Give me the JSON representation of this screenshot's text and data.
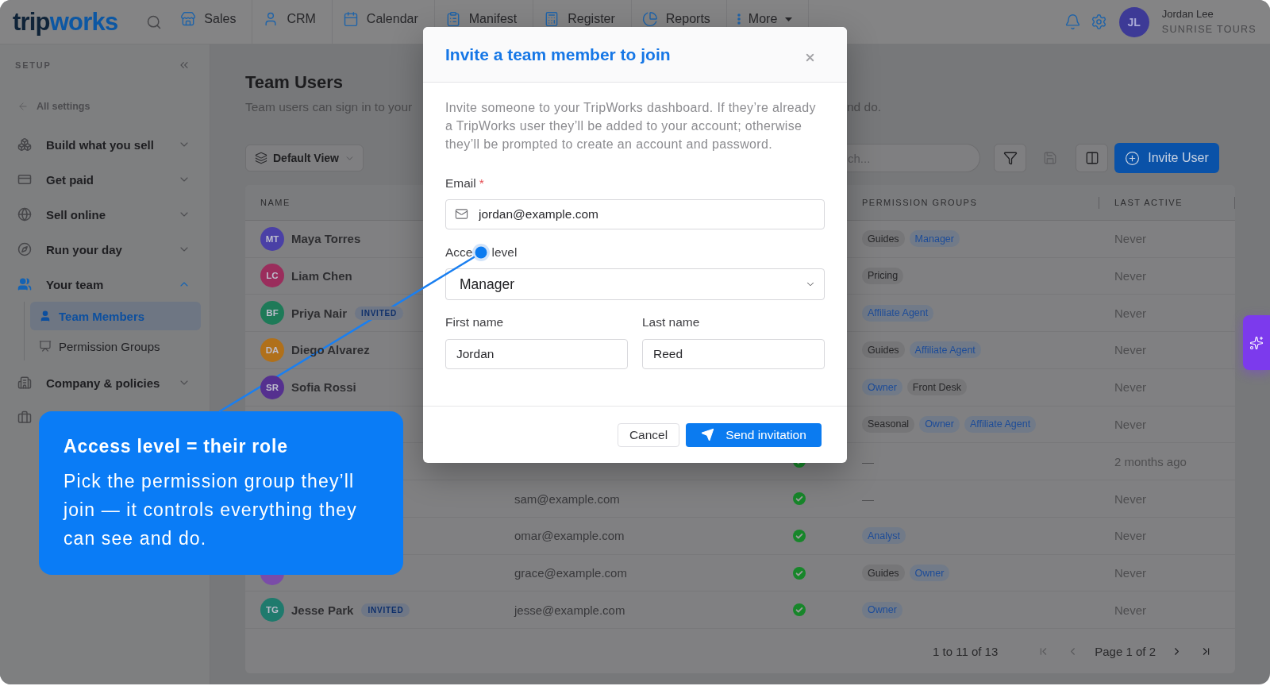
{
  "topbar": {
    "logo": {
      "primary": "trip",
      "accent": "works"
    },
    "nav": [
      {
        "label": "Sales",
        "kind": "link"
      },
      {
        "label": "CRM",
        "kind": "link"
      },
      {
        "label": "Calendar",
        "kind": "link"
      },
      {
        "label": "Manifest",
        "kind": "link"
      },
      {
        "label": "Register",
        "kind": "link"
      },
      {
        "label": "Reports",
        "kind": "link"
      },
      {
        "label": "More",
        "kind": "menu"
      }
    ],
    "user": {
      "initials": "JL",
      "name": "Jordan Lee",
      "company": "SUNRISE TOURS"
    }
  },
  "sidebar": {
    "title": "SETUP",
    "back_link": "All settings",
    "items": [
      {
        "kind": "section",
        "label": "Build what you sell",
        "expanded": false
      },
      {
        "kind": "section",
        "label": "Get paid",
        "expanded": false
      },
      {
        "kind": "section",
        "label": "Sell online",
        "expanded": false
      },
      {
        "kind": "section",
        "label": "Run your day",
        "expanded": false
      },
      {
        "kind": "section",
        "label": "Your team",
        "expanded": true,
        "children": [
          {
            "label": "Team Members",
            "selected": true
          },
          {
            "label": "Permission Groups",
            "selected": false
          }
        ]
      },
      {
        "kind": "section",
        "label": "Company & policies",
        "expanded": false
      },
      {
        "kind": "icon_only"
      }
    ]
  },
  "page": {
    "title": "Team Users",
    "subtitle_start": "Team users can sign in to your",
    "subtitle_end": "nd do."
  },
  "toolbar": {
    "view": "Default View",
    "search": {
      "placeholder": "ch..."
    },
    "tools": [
      {
        "disabled": false
      },
      {
        "disabled": true
      },
      {
        "disabled": false
      }
    ],
    "invite": "Invite User"
  },
  "table": {
    "header": {
      "name": "NAME",
      "permission_groups": "PERMISSION GROUPS",
      "last_active": "LAST ACTIVE"
    },
    "rows": [
      {
        "avatar": {
          "initials": "MT",
          "color": "#4a40a6"
        },
        "name": "Maya Torres",
        "groups": [
          {
            "label": "Guides",
            "kind": "neutral"
          },
          {
            "label": "Manager",
            "kind": "accent"
          }
        ],
        "last_active": "Never"
      },
      {
        "avatar": {
          "initials": "LC",
          "color": "#9a2d5c"
        },
        "name": "Liam Chen",
        "groups": [
          {
            "label": "Pricing",
            "kind": "neutral"
          }
        ],
        "last_active": "Never"
      },
      {
        "avatar": {
          "initials": "BF",
          "color": "#1e7a58"
        },
        "name": "Priya Nair",
        "badge": "INVITED",
        "groups": [
          {
            "label": "Affiliate Agent",
            "kind": "accent"
          }
        ],
        "last_active": "Never"
      },
      {
        "avatar": {
          "initials": "DA",
          "color": "#b0701a"
        },
        "name": "Diego Alvarez",
        "groups": [
          {
            "label": "Guides",
            "kind": "neutral"
          },
          {
            "label": "Affiliate Agent",
            "kind": "accent"
          }
        ],
        "last_active": "Never"
      },
      {
        "avatar": {
          "initials": "SR",
          "color": "#55308f"
        },
        "name": "Sofia Rossi",
        "groups": [
          {
            "label": "Owner",
            "kind": "accent"
          },
          {
            "label": "Front Desk",
            "kind": "neutral"
          }
        ],
        "last_active": "Never"
      },
      {
        "groups": [
          {
            "label": "Seasonal",
            "kind": "neutral"
          },
          {
            "label": "Owner",
            "kind": "accent"
          },
          {
            "label": "Affiliate Agent",
            "kind": "accent"
          }
        ],
        "last_active": "Never"
      },
      {
        "verified": true,
        "groups_empty": "—",
        "last_active": "2 months ago"
      },
      {
        "email": "sam@example.com",
        "verified": true,
        "groups_empty": "—",
        "last_active": "Never"
      },
      {
        "email": "omar@example.com",
        "verified": true,
        "groups": [
          {
            "label": "Analyst",
            "kind": "accent"
          }
        ],
        "last_active": "Never"
      },
      {
        "avatar": {
          "color": "#7a4ca8"
        },
        "email": "grace@example.com",
        "verified": true,
        "groups": [
          {
            "label": "Guides",
            "kind": "neutral"
          },
          {
            "label": "Owner",
            "kind": "accent"
          }
        ],
        "last_active": "Never"
      },
      {
        "avatar": {
          "initials": "TG",
          "color": "#1f7a6d"
        },
        "name": "Jesse Park",
        "badge": "INVITED",
        "email": "jesse@example.com",
        "verified": true,
        "groups": [
          {
            "label": "Owner",
            "kind": "accent"
          }
        ],
        "last_active": "Never"
      }
    ],
    "pagination": {
      "range": "1 to 11 of 13",
      "page": "Page 1 of 2",
      "buttons": [
        {
          "disabled": true
        },
        {
          "disabled": true
        },
        {
          "disabled": false
        },
        {
          "disabled": false
        }
      ]
    }
  },
  "modal": {
    "title": "Invite a team member to join",
    "description": "Invite someone to your TripWorks dashboard. If they’re already a TripWorks user they’ll be added to your account; otherwise they’ll be prompted to create an account and password.",
    "email": {
      "label": "Email",
      "required_mark": "*",
      "value": "jordan@example.com"
    },
    "access_level": {
      "label_parts": [
        "Acce",
        "level"
      ],
      "value": "Manager"
    },
    "first_name": {
      "label": "First name",
      "value": "Jordan"
    },
    "last_name": {
      "label": "Last name",
      "value": "Reed"
    },
    "buttons": {
      "cancel": "Cancel",
      "submit": "Send invitation"
    }
  },
  "callout": {
    "title": "Access level = their role",
    "body": "Pick the permission group they’ll join — it controls everything they can see and do."
  }
}
